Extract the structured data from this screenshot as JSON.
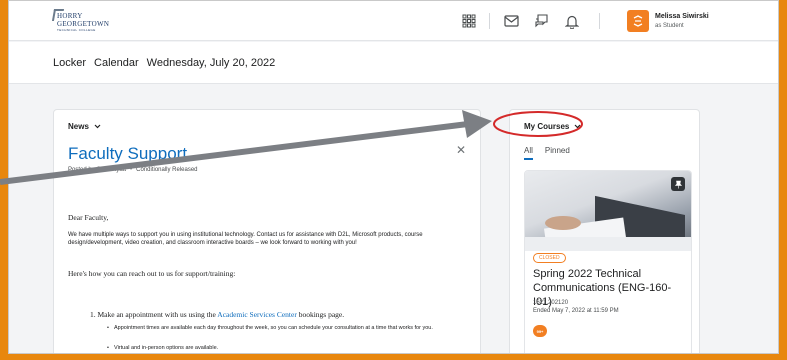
{
  "brand": {
    "line1": "HORRY",
    "line2": "GEORGETOWN",
    "line3": "TECHNICAL COLLEGE",
    "accent": "#f27f22",
    "link_color": "#0f6dbd"
  },
  "topbar": {
    "icons": [
      "apps-grid-icon",
      "mail-icon",
      "chat-icon",
      "bell-icon"
    ],
    "user_name": "Melissa Siwirski",
    "user_role": "as Student"
  },
  "nav": {
    "items": [
      "Locker",
      "Calendar",
      "Wednesday, July 20, 2022"
    ]
  },
  "news": {
    "header": "News",
    "title": "Faculty Support",
    "posted_by": "Posted by Chris Hyatt",
    "release": "Conditionally Released",
    "greeting": "Dear Faculty,",
    "para1": "We have multiple ways to support you in using institutional technology. Contact us for assistance with D2L, Microsoft products, course design/development, video creation, and classroom interactive boards – we look forward to working with you!",
    "para2": "Here's how you can reach out to us for support/training:",
    "item1_pre": "1. Make an appointment with us using the ",
    "item1_link": "Academic Services Center",
    "item1_post": " bookings page.",
    "bullet1": "Appointment times are available each day throughout the week, so you can schedule your consultation at a time that works for you.",
    "bullet2": "Virtual and in-person options are available."
  },
  "courses": {
    "header": "My Courses",
    "tabs": [
      "All",
      "Pinned"
    ],
    "card": {
      "badge": "CLOSED",
      "title": "Spring 2022 Technical Communications (ENG-160-I01)",
      "code": "1621.202120",
      "ended": "Ended May 7, 2022 at 11:59 PM",
      "notification_count": "99+"
    }
  },
  "annotation": {
    "arrow_color": "#7c7f84",
    "circle_color": "#d42a2a"
  }
}
